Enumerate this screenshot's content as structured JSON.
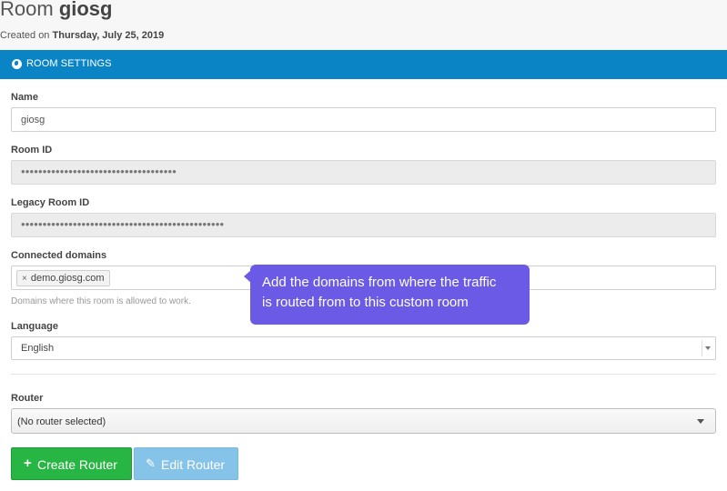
{
  "header": {
    "title_prefix": "Room",
    "title_name": "giosg",
    "created_prefix": "Created on",
    "created_date": "Thursday, July 25, 2019"
  },
  "panel": {
    "icon": "globe-icon",
    "title": "ROOM SETTINGS"
  },
  "form": {
    "name_label": "Name",
    "name_value": "giosg",
    "room_id_label": "Room ID",
    "room_id_value": "••••••••••••••••••••••••••••••••••••",
    "legacy_room_id_label": "Legacy Room ID",
    "legacy_room_id_value": "•••••••••••••••••••••••••••••••••••••••••••••••",
    "domains_label": "Connected domains",
    "domain_tags": [
      {
        "remove": "×",
        "label": "demo.giosg.com"
      }
    ],
    "domains_help": "Domains where this room is allowed to work.",
    "language_label": "Language",
    "language_value": "English",
    "router_label": "Router",
    "router_value": "(No router selected)"
  },
  "buttons": {
    "create_router": "Create Router",
    "create_icon": "plus-icon",
    "edit_router": "Edit Router",
    "edit_icon": "pencil-icon"
  },
  "tooltip": {
    "line1": "Add the domains from where the traffic",
    "line2": "is routed from to this custom room"
  },
  "colors": {
    "panel_heading": "#0b84c6",
    "create_button": "#27b543",
    "edit_button": "#86c3e8",
    "tooltip_bg": "#6a5ae6"
  }
}
